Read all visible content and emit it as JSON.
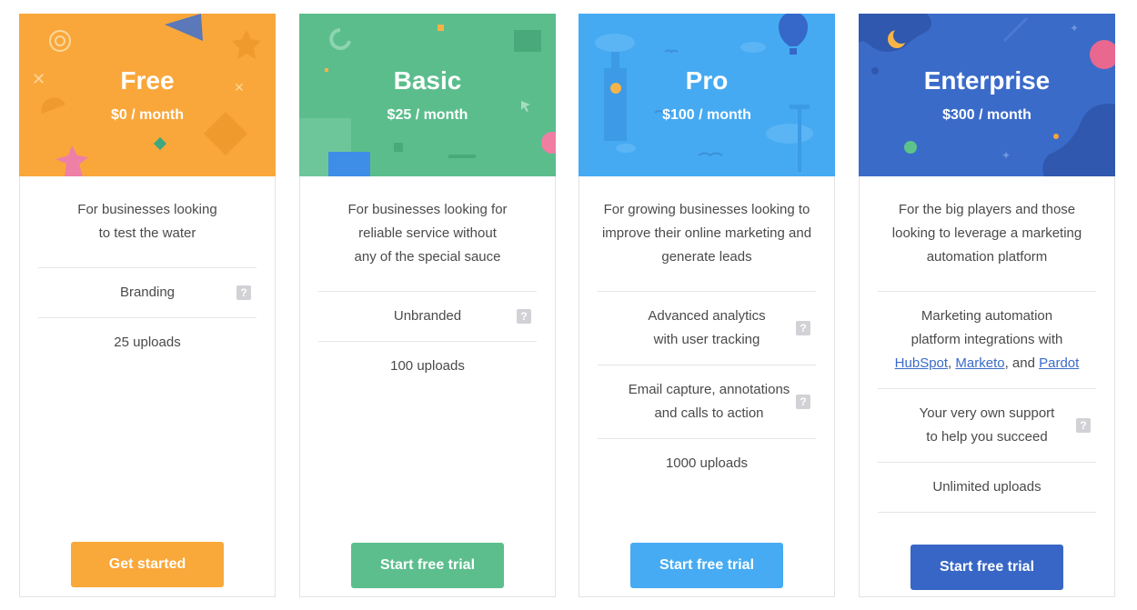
{
  "plans": [
    {
      "name": "Free",
      "price": "$0 / month",
      "color": "#F9A73B",
      "description": [
        "For businesses looking",
        "to test the water"
      ],
      "features": [
        {
          "text": "Branding",
          "help": "?"
        },
        {
          "text": "25 uploads"
        }
      ],
      "cta": "Get started"
    },
    {
      "name": "Basic",
      "price": "$25 / month",
      "color": "#5BBD8C",
      "description": [
        "For businesses looking for",
        "reliable service without",
        "any of the special sauce"
      ],
      "features": [
        {
          "text": "Unbranded",
          "help": "?"
        },
        {
          "text": "100 uploads"
        }
      ],
      "cta": "Start free trial"
    },
    {
      "name": "Pro",
      "price": "$100 / month",
      "color": "#45AAF2",
      "description": [
        "For growing businesses looking to",
        "improve their online marketing and",
        "generate leads"
      ],
      "features": [
        {
          "text": "Advanced analytics with user tracking",
          "help": "?"
        },
        {
          "text": "Email capture, annotations and calls to action",
          "help": "?"
        },
        {
          "text": "1000 uploads"
        }
      ],
      "cta": "Start free trial"
    },
    {
      "name": "Enterprise",
      "price": "$300 / month",
      "color": "#3A6BC9",
      "description": [
        "For the big players and those",
        "looking to leverage a marketing",
        "automation platform"
      ],
      "features": [
        {
          "text": "Marketing automation platform integrations with",
          "links": [
            "HubSpot",
            "Marketo",
            "Pardot"
          ],
          "sep1": ", ",
          "sep2": ", and "
        },
        {
          "text": "Your very own support to help you succeed",
          "help": "?"
        },
        {
          "text": "Unlimited uploads"
        }
      ],
      "cta": "Start free trial"
    }
  ]
}
